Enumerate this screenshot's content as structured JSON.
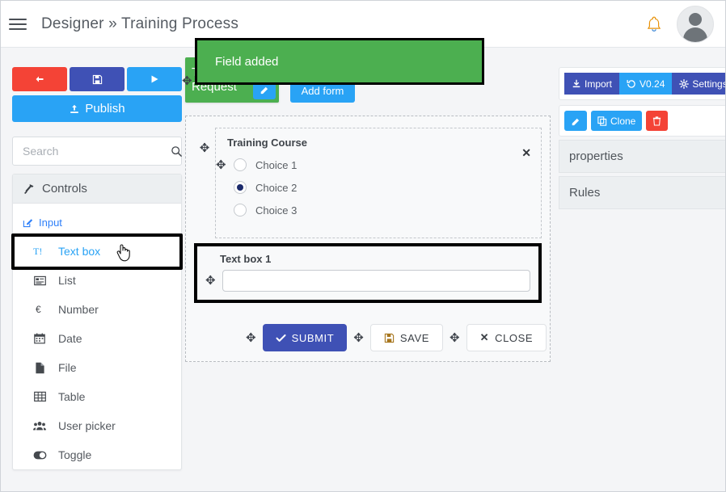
{
  "header": {
    "menu_icon": "hamburger-icon",
    "title": "Designer » Training Process",
    "bell_icon": "bell-icon",
    "avatar_icon": "user-avatar"
  },
  "toast": {
    "message": "Field added",
    "color": "#4caf50"
  },
  "sidebar": {
    "toolbar": [
      {
        "name": "back-button",
        "icon": "arrow-left-icon",
        "color": "#f44336"
      },
      {
        "name": "save-button",
        "icon": "floppy-disk-icon",
        "color": "#3f51b5"
      },
      {
        "name": "run-button",
        "icon": "play-icon",
        "color": "#29a3f5"
      }
    ],
    "publish_label": "Publish",
    "publish_icon": "upload-icon",
    "search": {
      "placeholder": "Search",
      "value": "",
      "icon": "search-icon"
    },
    "controls_header": {
      "label": "Controls",
      "icon": "hammer-icon"
    },
    "input_link": {
      "label": "Input",
      "icon": "edit-square-icon"
    },
    "items": [
      {
        "label": "Text box",
        "icon": "text-box-icon",
        "active": true
      },
      {
        "label": "List",
        "icon": "list-icon",
        "active": false
      },
      {
        "label": "Number",
        "icon": "euro-icon",
        "active": false
      },
      {
        "label": "Date",
        "icon": "calendar-icon",
        "active": false
      },
      {
        "label": "File",
        "icon": "file-icon",
        "active": false
      },
      {
        "label": "Table",
        "icon": "table-icon",
        "active": false
      },
      {
        "label": "User picker",
        "icon": "users-icon",
        "active": false
      },
      {
        "label": "Toggle",
        "icon": "toggle-icon",
        "active": false
      }
    ]
  },
  "center": {
    "tab": {
      "label": "Training Request",
      "edit_icon": "pencil-icon",
      "move_icon": "move-icon",
      "color": "#4caf50"
    },
    "add_form": {
      "label": "Add form",
      "icon": "plus-icon"
    },
    "form": {
      "group": {
        "title": "Training Course",
        "close_icon": "close-icon",
        "choices": [
          {
            "label": "Choice 1",
            "checked": false
          },
          {
            "label": "Choice 2",
            "checked": true
          },
          {
            "label": "Choice 3",
            "checked": false
          }
        ]
      },
      "textbox": {
        "label": "Text box 1",
        "value": "",
        "placeholder": ""
      },
      "actions": [
        {
          "label": "SUBMIT",
          "icon": "check-icon",
          "style": "primary"
        },
        {
          "label": "SAVE",
          "icon": "floppy-disk-icon",
          "style": "light"
        },
        {
          "label": "CLOSE",
          "icon": "close-icon",
          "style": "light"
        }
      ]
    }
  },
  "right": {
    "top_buttons": [
      {
        "label": "Import",
        "icon": "download-icon",
        "color": "#3f51b5"
      },
      {
        "label": "V0.24",
        "icon": "history-icon",
        "color": "#29a3f5"
      },
      {
        "label": "Settings",
        "icon": "gear-icon",
        "color": "#3f51b5"
      }
    ],
    "action_buttons": [
      {
        "label": "",
        "icon": "pencil-icon",
        "color": "#29a3f5"
      },
      {
        "label": "Clone",
        "icon": "copy-icon",
        "color": "#29a3f5"
      },
      {
        "label": "",
        "icon": "trash-icon",
        "color": "#f44336"
      }
    ],
    "sections": [
      {
        "label": "properties"
      },
      {
        "label": "Rules"
      }
    ]
  }
}
